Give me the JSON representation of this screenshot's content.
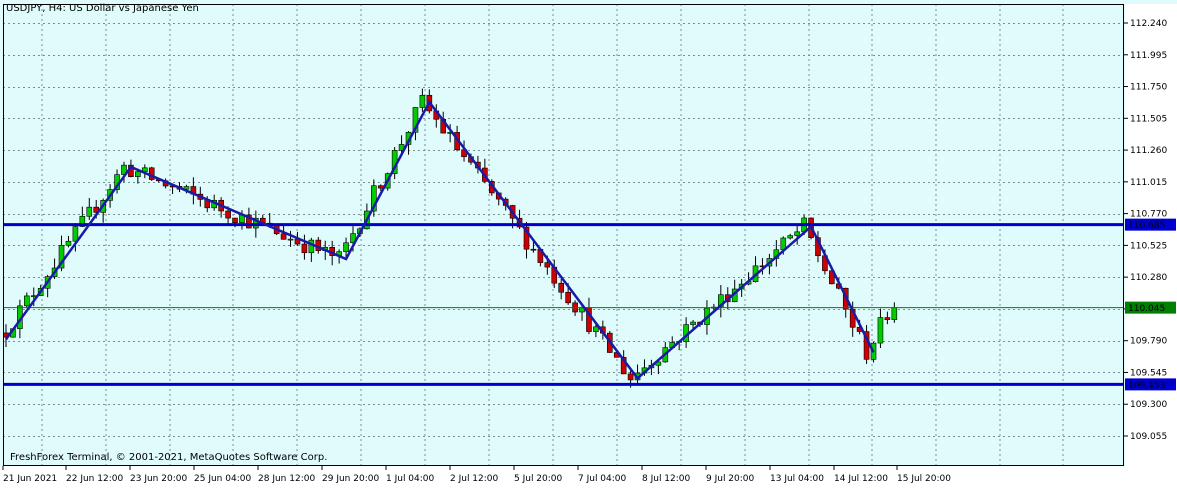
{
  "symbol": "USDJPY",
  "timeframe": "H4",
  "description": "US Dollar vs Japanese Yen",
  "title": "USDJPY, H4:  US Dollar vs Japanese Yen",
  "copyright": "FreshForex Terminal, © 2001-2021, MetaQuotes Software Corp.",
  "colors": {
    "background": "#e0fbfb",
    "grid": "#7a8f8f",
    "bull": "#00cc00",
    "bear": "#cc0000",
    "wick": "#000000",
    "level_line": "#0000cc",
    "zigzag": "#1a1aa8",
    "bid_line": "#008000"
  },
  "chart_data": {
    "type": "candlestick",
    "title": "USDJPY, H4:  US Dollar vs Japanese Yen",
    "ylim": [
      108.95,
      112.35
    ],
    "y_ticks": [
      "112.240",
      "111.995",
      "111.750",
      "111.505",
      "111.260",
      "111.015",
      "110.770",
      "110.525",
      "110.280",
      "110.035",
      "109.790",
      "109.545",
      "109.300",
      "109.055"
    ],
    "x_labels": [
      "21 Jun 2021",
      "22 Jun 12:00",
      "23 Jun 20:00",
      "25 Jun 04:00",
      "28 Jun 12:00",
      "29 Jun 20:00",
      "1 Jul 04:00",
      "2 Jul 12:00",
      "5 Jul 20:00",
      "7 Jul 04:00",
      "8 Jul 12:00",
      "9 Jul 20:00",
      "13 Jul 04:00",
      "14 Jul 12:00",
      "15 Jul 20:00"
    ],
    "grid": true,
    "horizontal_levels": [
      {
        "price": 110.685,
        "label": "110.685"
      },
      {
        "price": 109.453,
        "label": "109.453"
      }
    ],
    "bid": {
      "price": 110.045,
      "label": "110.045"
    },
    "zigzag": [
      {
        "bar": 0,
        "price": 109.8
      },
      {
        "bar": 18,
        "price": 111.13
      },
      {
        "bar": 49,
        "price": 110.42
      },
      {
        "bar": 61,
        "price": 111.63
      },
      {
        "bar": 91,
        "price": 109.5
      },
      {
        "bar": 116,
        "price": 110.67
      },
      {
        "bar": 125,
        "price": 109.7
      }
    ]
  }
}
